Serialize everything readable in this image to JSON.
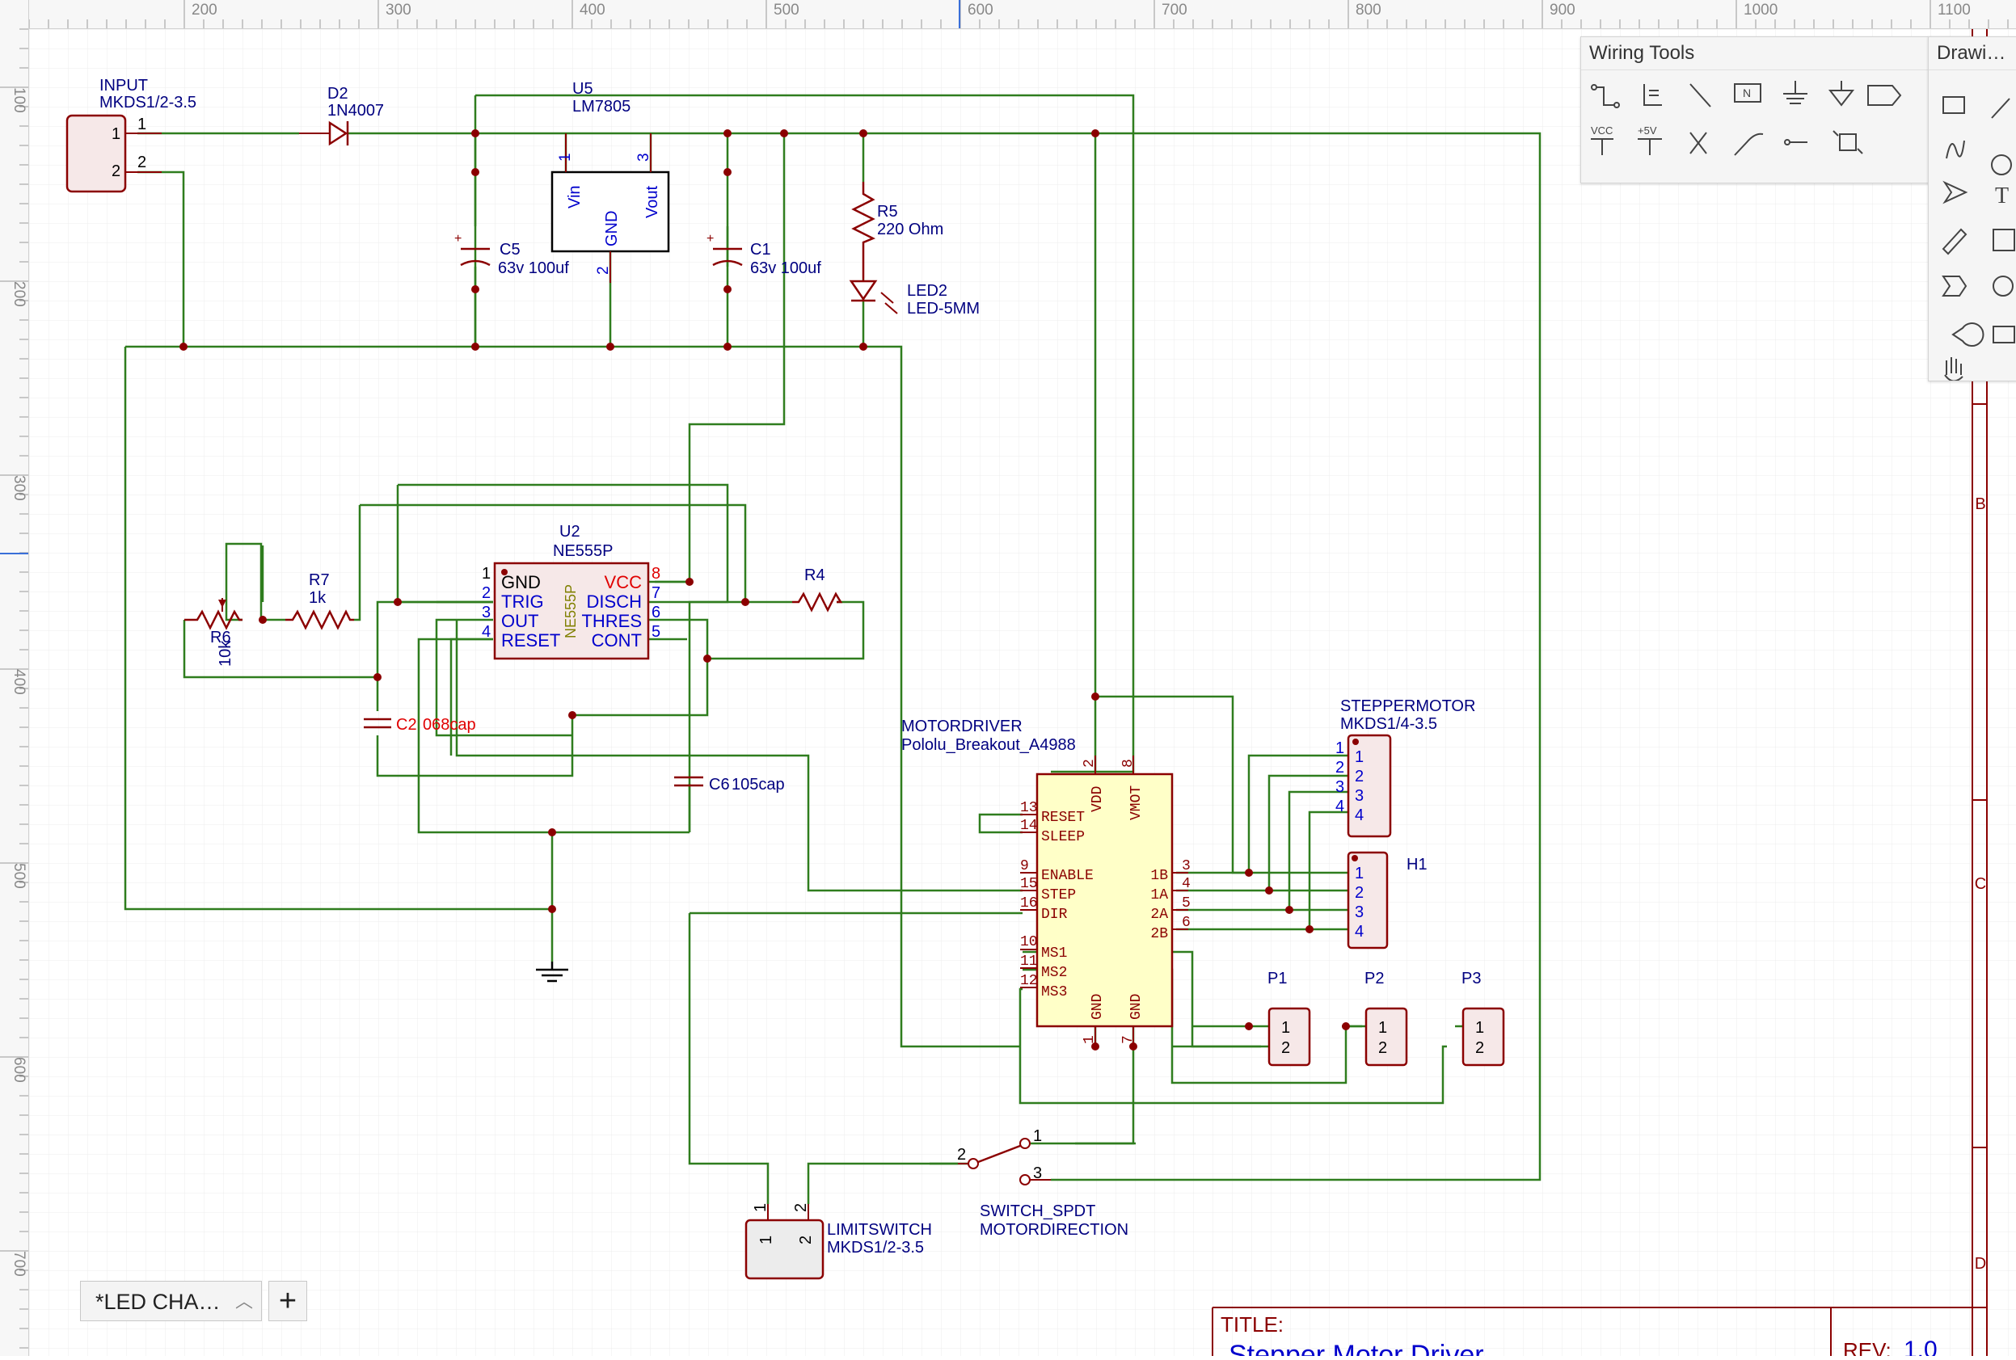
{
  "ruler": {
    "top_ticks": [
      "200",
      "300",
      "400",
      "500",
      "600",
      "700",
      "800",
      "900",
      "1000",
      "1100"
    ],
    "left_ticks": [
      "100",
      "200",
      "300",
      "400",
      "500",
      "600",
      "700"
    ]
  },
  "frame_zones": [
    "B",
    "C",
    "D"
  ],
  "components": {
    "input": {
      "ref": "INPUT",
      "value": "MKDS1/2-3.5",
      "pins": [
        "1",
        "2"
      ],
      "pin_labels": [
        "1",
        "2"
      ]
    },
    "d2": {
      "ref": "D2",
      "value": "1N4007"
    },
    "u5": {
      "ref": "U5",
      "value": "LM7805",
      "pins": [
        "1",
        "2",
        "3"
      ],
      "pin_names": [
        "Vin",
        "GND",
        "Vout"
      ]
    },
    "c5": {
      "ref": "C5",
      "value": "63v 100uf"
    },
    "c1": {
      "ref": "C1",
      "value": "63v 100uf"
    },
    "r5": {
      "ref": "R5",
      "value": "220 Ohm"
    },
    "led2": {
      "ref": "LED2",
      "value": "LED-5MM"
    },
    "u2": {
      "ref": "U2",
      "value": "NE555P",
      "body": "NE555P",
      "pins_left": [
        "1",
        "2",
        "3",
        "4"
      ],
      "names_left": [
        "GND",
        "TRIG",
        "OUT",
        "RESET"
      ],
      "pins_right": [
        "8",
        "7",
        "6",
        "5"
      ],
      "names_right": [
        "VCC",
        "DISCH",
        "THRES",
        "CONT"
      ]
    },
    "r7": {
      "ref": "R7",
      "value": "1k"
    },
    "r6": {
      "ref": "R6",
      "value": "10k"
    },
    "r4": {
      "ref": "R4"
    },
    "c2": {
      "ref": "C2",
      "value": "068cap"
    },
    "c6": {
      "ref": "C6",
      "value": "105cap"
    },
    "motordriver": {
      "ref": "MOTORDRIVER",
      "value": "Pololu_Breakout_A4988",
      "left_pins": [
        "13",
        "14",
        "9",
        "15",
        "16",
        "10",
        "11",
        "12"
      ],
      "left_names": [
        "RESET",
        "SLEEP",
        "ENABLE",
        "STEP",
        "DIR",
        "MS1",
        "MS2",
        "MS3"
      ],
      "right_pins": [
        "3",
        "4",
        "5",
        "6"
      ],
      "right_names": [
        "1B",
        "1A",
        "2A",
        "2B"
      ],
      "top_pins": [
        "2",
        "8"
      ],
      "top_names": [
        "VDD",
        "VMOT"
      ],
      "bottom_pins": [
        "1",
        "7"
      ],
      "bottom_names": [
        "GND",
        "GND"
      ]
    },
    "stepper": {
      "ref": "STEPPERMOTOR",
      "value": "MKDS1/4-3.5",
      "pins": [
        "1",
        "2",
        "3",
        "4"
      ]
    },
    "h1": {
      "ref": "H1",
      "pins": [
        "1",
        "2",
        "3",
        "4"
      ]
    },
    "p1": {
      "ref": "P1",
      "pins": [
        "1",
        "2"
      ]
    },
    "p2": {
      "ref": "P2",
      "pins": [
        "1",
        "2"
      ]
    },
    "p3": {
      "ref": "P3",
      "pins": [
        "1",
        "2"
      ]
    },
    "limitswitch": {
      "ref": "LIMITSWITCH",
      "value": "MKDS1/2-3.5",
      "pins": [
        "1",
        "2"
      ]
    },
    "switch": {
      "ref": "SWITCH_SPDT",
      "value": "MOTORDIRECTION",
      "pins": [
        "1",
        "2",
        "3"
      ]
    }
  },
  "title_block": {
    "title_label": "TITLE:",
    "title": "Stepper Motor Driver",
    "rev_label": "REV:",
    "rev": "1.0"
  },
  "wiring_tools": {
    "title": "Wiring Tools",
    "minimize": "—",
    "icons": [
      "wire-icon",
      "bus-icon",
      "bus-entry-icon",
      "net-label-icon",
      "ground-icon",
      "power-icon",
      "port-icon",
      "vcc-icon",
      "plus5v-icon",
      "no-connect-icon",
      "probe-icon",
      "pin-icon",
      "sheet-icon"
    ],
    "vcc_label": "VCC",
    "plus5v_label": "+5V",
    "net_label": "N"
  },
  "drawing_tools": {
    "title": "Drawi…"
  },
  "tab": {
    "label": "*LED CHA…",
    "add": "+"
  }
}
